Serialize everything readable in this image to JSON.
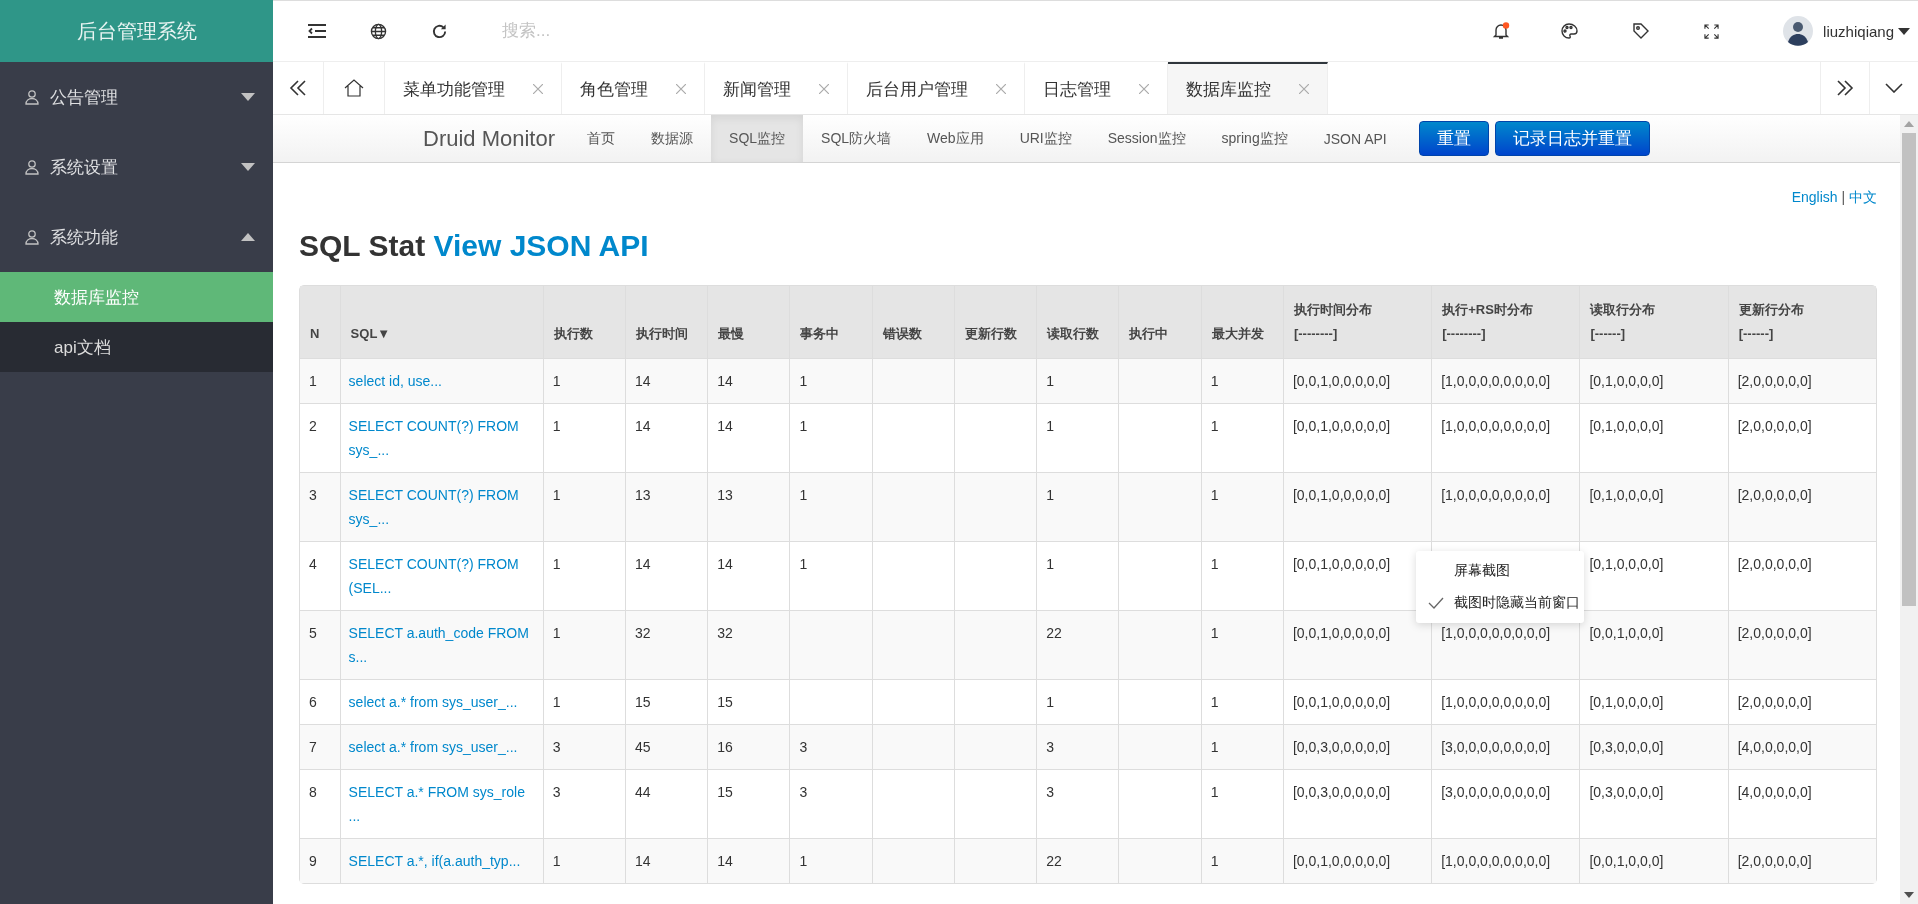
{
  "sidebar": {
    "title": "后台管理系统",
    "items": [
      {
        "label": "公告管理",
        "expanded": false
      },
      {
        "label": "系统设置",
        "expanded": false
      },
      {
        "label": "系统功能",
        "expanded": true,
        "children": [
          {
            "label": "数据库监控",
            "selected": true
          },
          {
            "label": "api文档",
            "selected": false
          }
        ]
      }
    ]
  },
  "header": {
    "search": {
      "placeholder": "搜索..."
    },
    "has_unread": true,
    "user": {
      "name": "liuzhiqiang"
    }
  },
  "tabs": [
    {
      "label": "菜单功能管理",
      "selected": false
    },
    {
      "label": "角色管理",
      "selected": false
    },
    {
      "label": "新闻管理",
      "selected": false
    },
    {
      "label": "后台用户管理",
      "selected": false
    },
    {
      "label": "日志管理",
      "selected": false
    },
    {
      "label": "数据库监控",
      "selected": true
    }
  ],
  "druid": {
    "brand": "Druid Monitor",
    "nav": [
      {
        "label": "首页",
        "selected": false
      },
      {
        "label": "数据源",
        "selected": false
      },
      {
        "label": "SQL监控",
        "selected": true
      },
      {
        "label": "SQL防火墙",
        "selected": false
      },
      {
        "label": "Web应用",
        "selected": false
      },
      {
        "label": "URI监控",
        "selected": false
      },
      {
        "label": "Session监控",
        "selected": false
      },
      {
        "label": "spring监控",
        "selected": false
      },
      {
        "label": "JSON API",
        "selected": false
      }
    ],
    "buttons": [
      "重置",
      "记录日志并重置"
    ]
  },
  "languages": {
    "items": [
      "English",
      "中文"
    ],
    "separator": "|"
  },
  "heading": {
    "title": "SQL Stat",
    "link": "View JSON API"
  },
  "table": {
    "columns": [
      {
        "label": "N"
      },
      {
        "label": "SQL▼"
      },
      {
        "label": "执行数"
      },
      {
        "label": "执行时间"
      },
      {
        "label": "最慢"
      },
      {
        "label": "事务中"
      },
      {
        "label": "错误数"
      },
      {
        "label": "更新行数"
      },
      {
        "label": "读取行数"
      },
      {
        "label": "执行中"
      },
      {
        "label": "最大并发"
      },
      {
        "label": "执行时间分布",
        "sub": "[--------]"
      },
      {
        "label": "执行+RS时分布",
        "sub": "[--------]"
      },
      {
        "label": "读取行分布",
        "sub": "[------]"
      },
      {
        "label": "更新行分布",
        "sub": "[------]"
      }
    ],
    "rows": [
      [
        "1",
        "select id, use...",
        "1",
        "14",
        "14",
        "1",
        null,
        null,
        "1",
        null,
        "1",
        "[0,0,1,0,0,0,0,0]",
        "[1,0,0,0,0,0,0,0,0]",
        "[0,1,0,0,0,0]",
        "[2,0,0,0,0,0]"
      ],
      [
        "2",
        "SELECT COUNT(?) FROM sys_...",
        "1",
        "14",
        "14",
        "1",
        null,
        null,
        "1",
        null,
        "1",
        "[0,0,1,0,0,0,0,0]",
        "[1,0,0,0,0,0,0,0,0]",
        "[0,1,0,0,0,0]",
        "[2,0,0,0,0,0]"
      ],
      [
        "3",
        "SELECT COUNT(?) FROM sys_...",
        "1",
        "13",
        "13",
        "1",
        null,
        null,
        "1",
        null,
        "1",
        "[0,0,1,0,0,0,0,0]",
        "[1,0,0,0,0,0,0,0,0]",
        "[0,1,0,0,0,0]",
        "[2,0,0,0,0,0]"
      ],
      [
        "4",
        "SELECT COUNT(?) FROM (SEL...",
        "1",
        "14",
        "14",
        "1",
        null,
        null,
        "1",
        null,
        "1",
        "[0,0,1,0,0,0,0,0]",
        null,
        "[0,1,0,0,0,0]",
        "[2,0,0,0,0,0]"
      ],
      [
        "5",
        "SELECT a.auth_code FROM s...",
        "1",
        "32",
        "32",
        null,
        null,
        null,
        "22",
        null,
        "1",
        "[0,0,1,0,0,0,0,0]",
        "[1,0,0,0,0,0,0,0,0]",
        "[0,0,1,0,0,0]",
        "[2,0,0,0,0,0]"
      ],
      [
        "6",
        "select a.* from sys_user_...",
        "1",
        "15",
        "15",
        null,
        null,
        null,
        "1",
        null,
        "1",
        "[0,0,1,0,0,0,0,0]",
        "[1,0,0,0,0,0,0,0,0]",
        "[0,1,0,0,0,0]",
        "[2,0,0,0,0,0]"
      ],
      [
        "7",
        "select a.* from sys_user_...",
        "3",
        "45",
        "16",
        "3",
        null,
        null,
        "3",
        null,
        "1",
        "[0,0,3,0,0,0,0,0]",
        "[3,0,0,0,0,0,0,0,0]",
        "[0,3,0,0,0,0]",
        "[4,0,0,0,0,0]"
      ],
      [
        "8",
        "SELECT a.* FROM sys_role ...",
        "3",
        "44",
        "15",
        "3",
        null,
        null,
        "3",
        null,
        "1",
        "[0,0,3,0,0,0,0,0]",
        "[3,0,0,0,0,0,0,0,0]",
        "[0,3,0,0,0,0]",
        "[4,0,0,0,0,0]"
      ],
      [
        "9",
        "SELECT a.*, if(a.auth_typ...",
        "1",
        "14",
        "14",
        "1",
        null,
        null,
        "22",
        null,
        "1",
        "[0,0,1,0,0,0,0,0]",
        "[1,0,0,0,0,0,0,0,0]",
        "[0,0,1,0,0,0]",
        "[2,0,0,0,0,0]"
      ]
    ]
  },
  "context_menu": {
    "items": [
      {
        "label": "屏幕截图",
        "checked": false
      },
      {
        "label": "截图时隐藏当前窗口",
        "checked": true
      }
    ]
  }
}
